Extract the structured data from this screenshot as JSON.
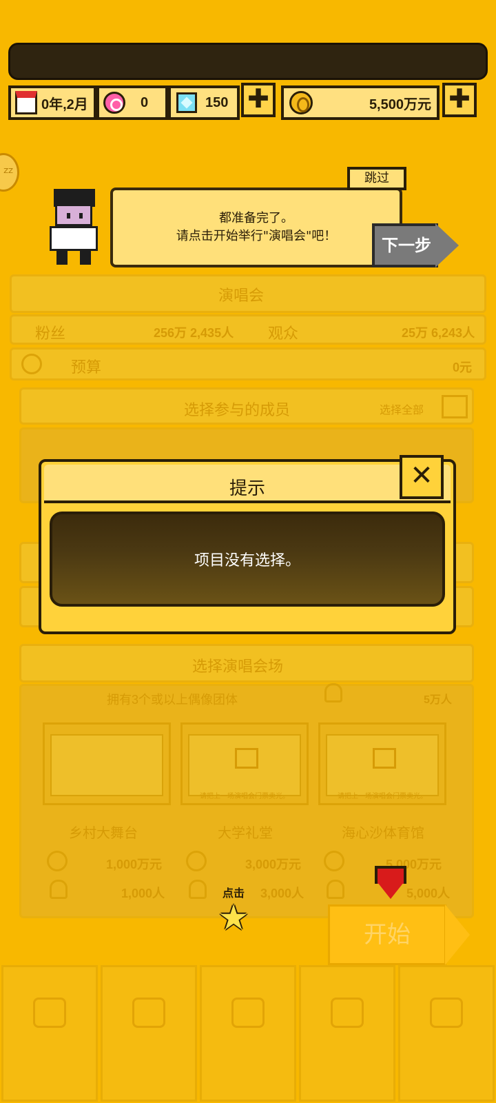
{
  "hud": {
    "date": "0年,2月",
    "hearts": "0",
    "diamonds": "150",
    "money": "5,500万元",
    "plus_label": "✚",
    "side_badge": "ZZ"
  },
  "tutorial": {
    "skip_label": "跳过",
    "line1": "都准备完了。",
    "line2": "请点击开始举行\"演唱会\"吧！",
    "next_label": "下一步"
  },
  "background": {
    "section_title": "演唱会",
    "fans_label": "粉丝",
    "fans_value": "256万 2,435人",
    "audience_label": "观众",
    "audience_value": "25万 6,243人",
    "budget_label": "预算",
    "budget_value": "0元",
    "members_title": "选择参与的成员",
    "select_all_label": "选择全部",
    "venue_title": "选择演唱会场",
    "requirement": "拥有3个或以上偶像团体",
    "requirement_count": "5万人",
    "venues": [
      {
        "name": "乡村大舞台",
        "cost": "1,000万元",
        "capacity": "1,000人",
        "note": ""
      },
      {
        "name": "大学礼堂",
        "cost": "3,000万元",
        "capacity": "3,000人",
        "note": "请把上一场演唱会门票卖光。"
      },
      {
        "name": "海心沙体育馆",
        "cost": "5,000万元",
        "capacity": "5,000人",
        "note": "请把上一场演唱会门票卖光。"
      }
    ],
    "start_label": "开始"
  },
  "dialog": {
    "title": "提示",
    "close_label": "✕",
    "message": "项目没有选择。"
  },
  "hint": {
    "tap_label": "点击",
    "star": "★"
  },
  "colors": {
    "background": "#f8b800",
    "dialog": "#ffd23a",
    "dialog_message_bg": "#3c2b0c",
    "outline": "#2a1e08"
  }
}
